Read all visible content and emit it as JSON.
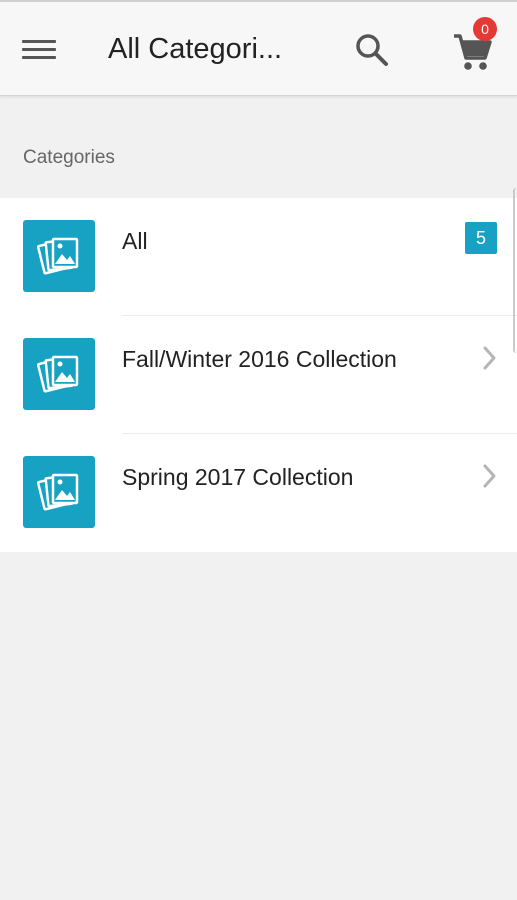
{
  "header": {
    "title": "All Categori...",
    "menu_icon": "hamburger-menu-icon",
    "search_icon": "search-icon",
    "cart_icon": "shopping-cart-icon",
    "cart_count": "0"
  },
  "section": {
    "title": "Categories"
  },
  "categories": [
    {
      "label": "All",
      "count": "5",
      "icon": "image-gallery-icon"
    },
    {
      "label": "Fall/Winter 2016 Collection",
      "icon": "image-gallery-icon",
      "trailing": "chevron-right-icon"
    },
    {
      "label": "Spring 2017 Collection",
      "icon": "image-gallery-icon",
      "trailing": "chevron-right-icon"
    }
  ],
  "colors": {
    "accent": "#17a2c3",
    "badge_red": "#e53935",
    "background": "#f1f1f1"
  }
}
